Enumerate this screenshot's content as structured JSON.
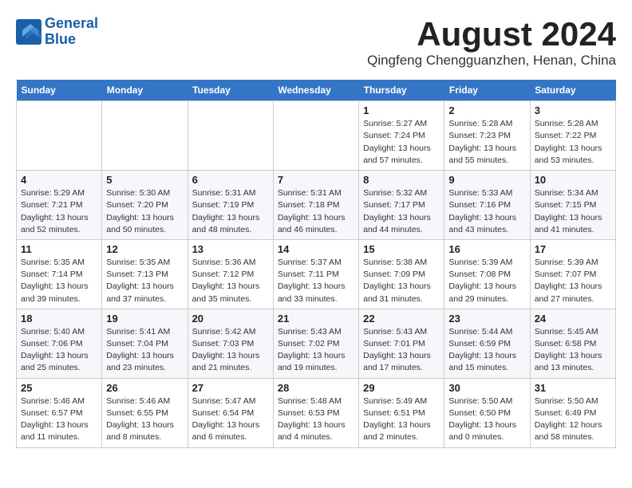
{
  "app": {
    "name_line1": "General",
    "name_line2": "Blue"
  },
  "header": {
    "month_year": "August 2024",
    "location": "Qingfeng Chengguanzhen, Henan, China"
  },
  "days_of_week": [
    "Sunday",
    "Monday",
    "Tuesday",
    "Wednesday",
    "Thursday",
    "Friday",
    "Saturday"
  ],
  "weeks": [
    [
      {
        "day": "",
        "info": ""
      },
      {
        "day": "",
        "info": ""
      },
      {
        "day": "",
        "info": ""
      },
      {
        "day": "",
        "info": ""
      },
      {
        "day": "1",
        "info": "Sunrise: 5:27 AM\nSunset: 7:24 PM\nDaylight: 13 hours\nand 57 minutes."
      },
      {
        "day": "2",
        "info": "Sunrise: 5:28 AM\nSunset: 7:23 PM\nDaylight: 13 hours\nand 55 minutes."
      },
      {
        "day": "3",
        "info": "Sunrise: 5:28 AM\nSunset: 7:22 PM\nDaylight: 13 hours\nand 53 minutes."
      }
    ],
    [
      {
        "day": "4",
        "info": "Sunrise: 5:29 AM\nSunset: 7:21 PM\nDaylight: 13 hours\nand 52 minutes."
      },
      {
        "day": "5",
        "info": "Sunrise: 5:30 AM\nSunset: 7:20 PM\nDaylight: 13 hours\nand 50 minutes."
      },
      {
        "day": "6",
        "info": "Sunrise: 5:31 AM\nSunset: 7:19 PM\nDaylight: 13 hours\nand 48 minutes."
      },
      {
        "day": "7",
        "info": "Sunrise: 5:31 AM\nSunset: 7:18 PM\nDaylight: 13 hours\nand 46 minutes."
      },
      {
        "day": "8",
        "info": "Sunrise: 5:32 AM\nSunset: 7:17 PM\nDaylight: 13 hours\nand 44 minutes."
      },
      {
        "day": "9",
        "info": "Sunrise: 5:33 AM\nSunset: 7:16 PM\nDaylight: 13 hours\nand 43 minutes."
      },
      {
        "day": "10",
        "info": "Sunrise: 5:34 AM\nSunset: 7:15 PM\nDaylight: 13 hours\nand 41 minutes."
      }
    ],
    [
      {
        "day": "11",
        "info": "Sunrise: 5:35 AM\nSunset: 7:14 PM\nDaylight: 13 hours\nand 39 minutes."
      },
      {
        "day": "12",
        "info": "Sunrise: 5:35 AM\nSunset: 7:13 PM\nDaylight: 13 hours\nand 37 minutes."
      },
      {
        "day": "13",
        "info": "Sunrise: 5:36 AM\nSunset: 7:12 PM\nDaylight: 13 hours\nand 35 minutes."
      },
      {
        "day": "14",
        "info": "Sunrise: 5:37 AM\nSunset: 7:11 PM\nDaylight: 13 hours\nand 33 minutes."
      },
      {
        "day": "15",
        "info": "Sunrise: 5:38 AM\nSunset: 7:09 PM\nDaylight: 13 hours\nand 31 minutes."
      },
      {
        "day": "16",
        "info": "Sunrise: 5:39 AM\nSunset: 7:08 PM\nDaylight: 13 hours\nand 29 minutes."
      },
      {
        "day": "17",
        "info": "Sunrise: 5:39 AM\nSunset: 7:07 PM\nDaylight: 13 hours\nand 27 minutes."
      }
    ],
    [
      {
        "day": "18",
        "info": "Sunrise: 5:40 AM\nSunset: 7:06 PM\nDaylight: 13 hours\nand 25 minutes."
      },
      {
        "day": "19",
        "info": "Sunrise: 5:41 AM\nSunset: 7:04 PM\nDaylight: 13 hours\nand 23 minutes."
      },
      {
        "day": "20",
        "info": "Sunrise: 5:42 AM\nSunset: 7:03 PM\nDaylight: 13 hours\nand 21 minutes."
      },
      {
        "day": "21",
        "info": "Sunrise: 5:43 AM\nSunset: 7:02 PM\nDaylight: 13 hours\nand 19 minutes."
      },
      {
        "day": "22",
        "info": "Sunrise: 5:43 AM\nSunset: 7:01 PM\nDaylight: 13 hours\nand 17 minutes."
      },
      {
        "day": "23",
        "info": "Sunrise: 5:44 AM\nSunset: 6:59 PM\nDaylight: 13 hours\nand 15 minutes."
      },
      {
        "day": "24",
        "info": "Sunrise: 5:45 AM\nSunset: 6:58 PM\nDaylight: 13 hours\nand 13 minutes."
      }
    ],
    [
      {
        "day": "25",
        "info": "Sunrise: 5:46 AM\nSunset: 6:57 PM\nDaylight: 13 hours\nand 11 minutes."
      },
      {
        "day": "26",
        "info": "Sunrise: 5:46 AM\nSunset: 6:55 PM\nDaylight: 13 hours\nand 8 minutes."
      },
      {
        "day": "27",
        "info": "Sunrise: 5:47 AM\nSunset: 6:54 PM\nDaylight: 13 hours\nand 6 minutes."
      },
      {
        "day": "28",
        "info": "Sunrise: 5:48 AM\nSunset: 6:53 PM\nDaylight: 13 hours\nand 4 minutes."
      },
      {
        "day": "29",
        "info": "Sunrise: 5:49 AM\nSunset: 6:51 PM\nDaylight: 13 hours\nand 2 minutes."
      },
      {
        "day": "30",
        "info": "Sunrise: 5:50 AM\nSunset: 6:50 PM\nDaylight: 13 hours\nand 0 minutes."
      },
      {
        "day": "31",
        "info": "Sunrise: 5:50 AM\nSunset: 6:49 PM\nDaylight: 12 hours\nand 58 minutes."
      }
    ]
  ]
}
